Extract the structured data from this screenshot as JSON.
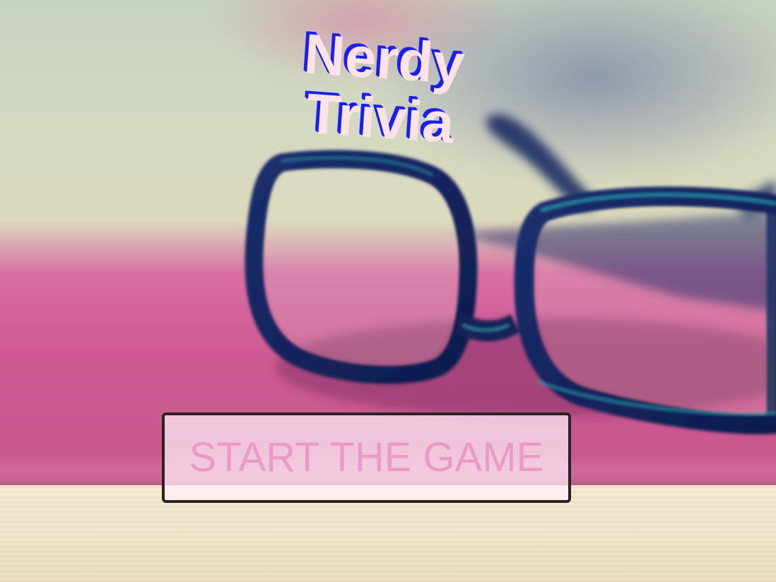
{
  "title": {
    "line1": "Nerdy",
    "line2": "Trivia"
  },
  "start_button": {
    "label": "START THE GAME"
  },
  "colors": {
    "title_fill": "#fde3e6",
    "title_shadow": "#1a1ff0",
    "button_text": "#ea9bc4",
    "button_border": "#2b2226"
  },
  "background": {
    "scene": "blurred photo of dark-framed glasses resting on a pink book"
  }
}
